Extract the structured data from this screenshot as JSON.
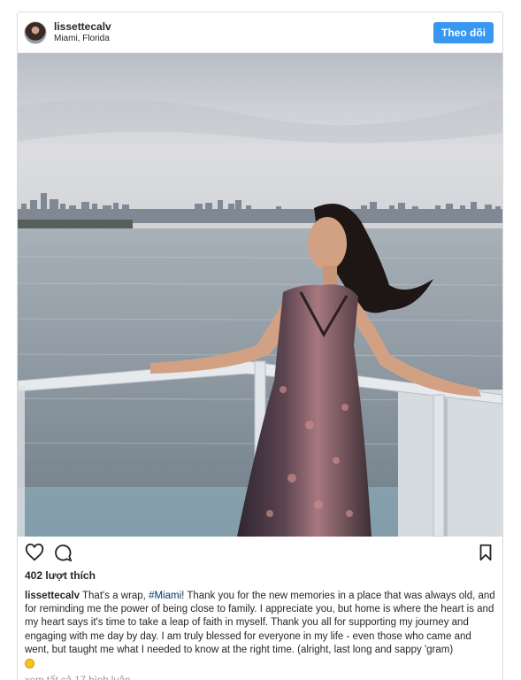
{
  "header": {
    "username": "lissettecalv",
    "location": "Miami, Florida",
    "follow_label": "Theo dõi"
  },
  "photo": {
    "colors": {
      "sky_top": "#c9cbcf",
      "sky_bottom": "#dfe0e2",
      "water": "#8d98a2",
      "skyline": "#7f8893",
      "dress_dark": "#3b2e34",
      "dress_pattern": "#a7787e",
      "skin": "#d2a183",
      "hair": "#1e1614",
      "railing": "#e7eaed"
    }
  },
  "actions": {
    "like_icon": "heart-icon",
    "comment_icon": "comment-icon",
    "save_icon": "bookmark-icon"
  },
  "likes": "402 lượt thích",
  "caption": {
    "username": "lissettecalv",
    "text_before": "That's a wrap, ",
    "hashtag": "#Miami",
    "text_after": "! Thank you for the new memories in a place that was always old, and for reminding me the power of being close to family. I appreciate you, but home is where the heart is and my heart says it's time to take a leap of faith in myself. Thank you all for supporting my journey and engaging with me day by day. I am truly blessed for everyone in my life - even those who came and went, but taught me what I needed to know at the right time. (alright, last long and sappy 'gram)",
    "emoji": "sunflower-emoji"
  },
  "view_comments": "xem tất cả 17 bình luận"
}
